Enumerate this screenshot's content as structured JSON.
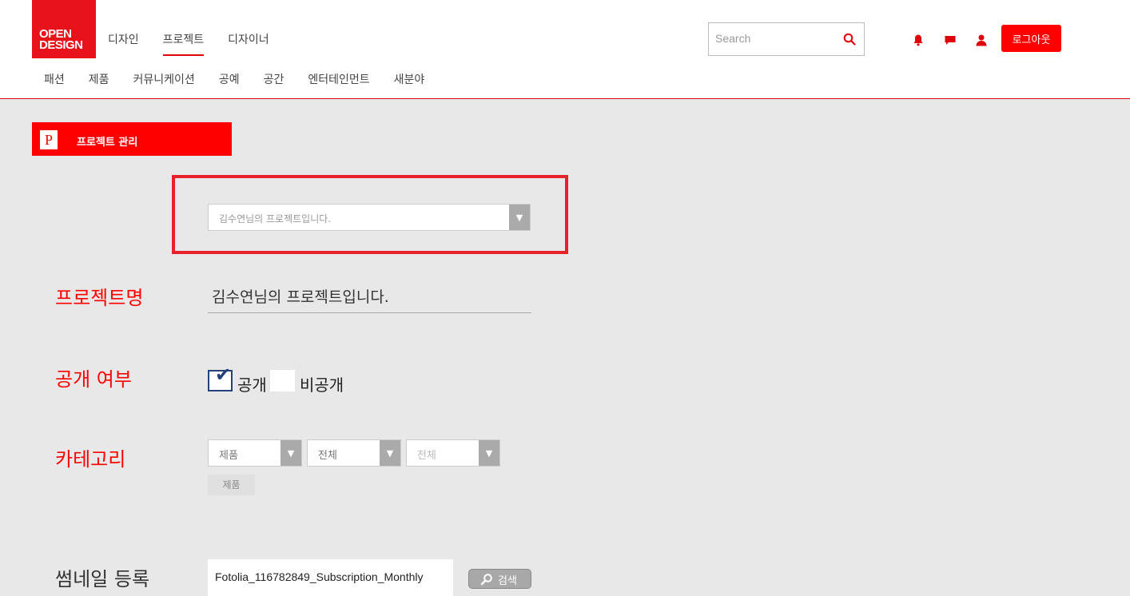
{
  "header": {
    "logo_line1": "OPEN",
    "logo_line2": "DESIGN",
    "main_nav": [
      "디자인",
      "프로젝트",
      "디자이너"
    ],
    "sub_nav": [
      "패션",
      "제품",
      "커뮤니케이션",
      "공예",
      "공간",
      "엔터테인먼트",
      "새분야"
    ],
    "search_placeholder": "Search",
    "logout_label": "로그아웃",
    "icons": [
      "bell-icon",
      "chat-icon",
      "user-icon"
    ],
    "accent_color": "#ff0000"
  },
  "section": {
    "badge": "P",
    "title": "프로젝트 관리"
  },
  "project_select": {
    "value": "김수연님의 프로젝트입니다.",
    "arrow": "▼"
  },
  "form": {
    "name_label": "프로젝트명",
    "name_value": "김수연님의 프로젝트입니다.",
    "visibility_label": "공개 여부",
    "public_label": "공개",
    "private_label": "비공개",
    "public_checked": true,
    "category_label": "카테고리",
    "category_selects": [
      "제품",
      "전체",
      "전체"
    ],
    "category_tag": "제품",
    "thumbnail_label": "썸네일 등록",
    "thumbnail_file": "Fotolia_116782849_Subscription_Monthly",
    "search_button": "검색"
  }
}
